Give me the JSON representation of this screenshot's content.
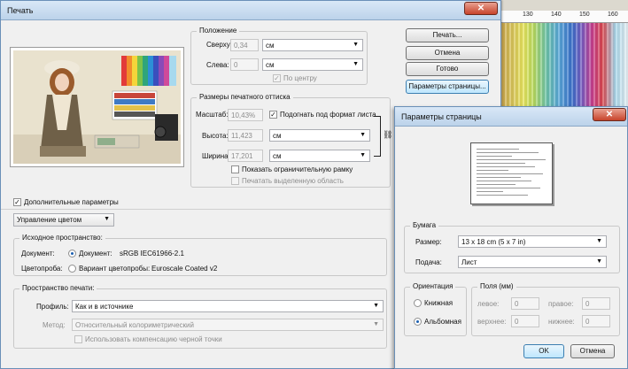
{
  "background_app": {
    "ruler_ticks": [
      "130",
      "140",
      "150",
      "160"
    ]
  },
  "print_dialog": {
    "title": "Печать",
    "position_group": {
      "label": "Положение",
      "top_label": "Сверху:",
      "top_value": "0,34",
      "top_unit": "см",
      "left_label": "Слева:",
      "left_value": "0",
      "left_unit": "см",
      "center_label": "По центру"
    },
    "size_group": {
      "label": "Размеры печатного оттиска",
      "scale_label": "Масштаб:",
      "scale_value": "10,43%",
      "fit_label": "Подогнать под формат листа",
      "height_label": "Высота:",
      "height_value": "11,423",
      "height_unit": "см",
      "width_label": "Ширина:",
      "width_value": "17,201",
      "width_unit": "см",
      "bbox_label": "Показать ограничительную рамку",
      "print_selection_label": "Печатать выделенную область"
    },
    "buttons": {
      "print": "Печать...",
      "cancel": "Отмена",
      "done": "Готово",
      "page_setup": "Параметры страницы..."
    },
    "more_options_label": "Дополнительные параметры",
    "color_management_select": "Управление цветом",
    "source_group": {
      "label": "Исходное пространство:",
      "document_label": "Документ:",
      "document_option": "Документ:",
      "document_profile": "sRGB IEC61966-2.1",
      "proof_label": "Цветопроба:",
      "proof_option": "Вариант цветопробы:",
      "proof_profile": "Euroscale Coated v2"
    },
    "print_space_group": {
      "label": "Пространство печати:",
      "profile_label": "Профиль:",
      "profile_value": "Как и в источнике",
      "intent_label": "Метод:",
      "intent_value": "Относительный колориметрический",
      "bpc_label": "Использовать компенсацию черной точки"
    }
  },
  "page_setup_dialog": {
    "title": "Параметры страницы",
    "paper_group": {
      "label": "Бумага",
      "size_label": "Размер:",
      "size_value": "13 x 18 cm (5 x 7 in)",
      "source_label": "Подача:",
      "source_value": "Лист"
    },
    "orientation_group": {
      "label": "Ориентация",
      "portrait": "Книжная",
      "landscape": "Альбомная",
      "selected": "landscape"
    },
    "margins_group": {
      "label": "Поля (мм)",
      "left_label": "левое:",
      "left_value": "0",
      "right_label": "правое:",
      "right_value": "0",
      "top_label": "верхнее:",
      "top_value": "0",
      "bottom_label": "нижнее:",
      "bottom_value": "0"
    },
    "buttons": {
      "ok": "OK",
      "cancel": "Отмена"
    }
  }
}
